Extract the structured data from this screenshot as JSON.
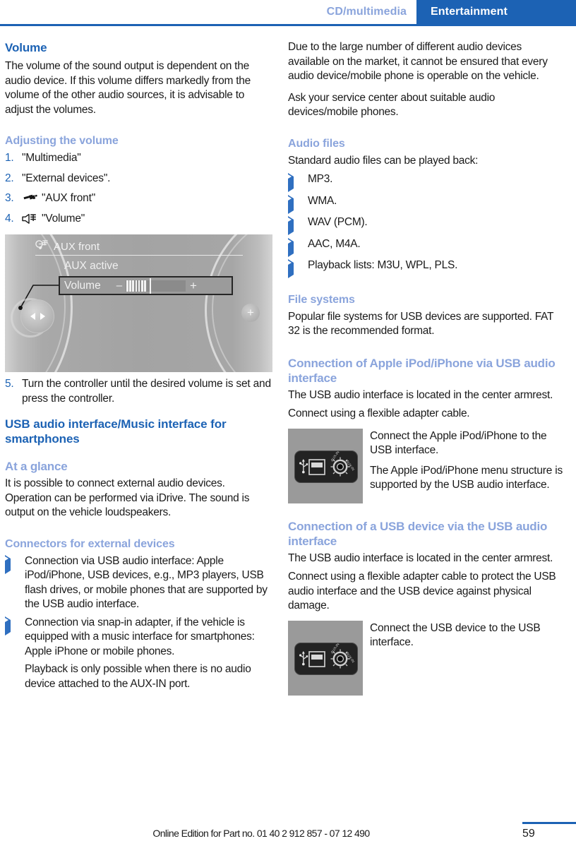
{
  "header": {
    "chapter": "CD/multimedia",
    "section": "Entertainment"
  },
  "left_column": {
    "volume_heading": "Volume",
    "volume_intro": "The volume of the sound output is dependent on the audio device. If this volume differs markedly from the volume of the other audio sources, it is advisable to adjust the volumes.",
    "adjusting_heading": "Adjusting the volume",
    "steps": [
      {
        "num": "1.",
        "icon": "",
        "text": "\"Multimedia\""
      },
      {
        "num": "2.",
        "icon": "",
        "text": "\"External devices\"."
      },
      {
        "num": "3.",
        "icon": "aux-plug-icon",
        "text": "\"AUX front\""
      },
      {
        "num": "4.",
        "icon": "speaker-volume-icon",
        "text": "\"Volume\""
      }
    ],
    "figure": {
      "title": "AUX front",
      "title_icon": "aux-front-icon",
      "status": "AUX active",
      "volume_label": "Volume",
      "minus": "–",
      "plus": "+"
    },
    "step5": {
      "num": "5.",
      "text": "Turn the controller until the desired volume is set and press the controller."
    },
    "usb_heading": "USB audio interface/Music interface for smartphones",
    "at_a_glance_heading": "At a glance",
    "at_a_glance_body": "It is possible to connect external audio devices. Operation can be performed via iDrive. The sound is output on the vehicle loudspeakers.",
    "connectors_heading": "Connectors for external devices",
    "connectors_bullets": [
      "Connection via USB audio interface: Apple iPod/iPhone, USB devices, e.g., MP3 players, USB flash drives, or mobile phones that are supported by the USB audio interface.",
      "Connection via snap-in adapter, if the vehicle is equipped with a music interface for smartphones: Apple iPhone or mobile phones."
    ],
    "connectors_note": "Playback is only possible when there is no audio device attached to the AUX-IN port."
  },
  "right_column": {
    "para_1": "Due to the large number of different audio devices available on the market, it cannot be ensured that every audio device/mobile phone is operable on the vehicle.",
    "para_2": "Ask your service center about suitable audio devices/mobile phones.",
    "audio_files_heading": "Audio files",
    "audio_files_intro": "Standard audio files can be played back:",
    "audio_files_bullets": [
      "MP3.",
      "WMA.",
      "WAV (PCM).",
      "AAC, M4A.",
      "Playback lists: M3U, WPL, PLS."
    ],
    "file_systems_heading": "File systems",
    "file_systems_body": "Popular file systems for USB devices are supported. FAT 32 is the recommended format.",
    "ipod_heading": "Connection of Apple iPod/iPhone via USB audio interface",
    "ipod_body_1": "The USB audio interface is located in the center armrest.",
    "ipod_body_2": "Connect using a flexible adapter cable.",
    "ipod_port_para_1": "Connect the Apple iPod/iPhone to the USB interface.",
    "ipod_port_para_2": "The Apple iPod/iPhone menu structure is supported by the USB audio interface.",
    "usbdev_heading": "Connection of a USB device via the USB audio interface",
    "usbdev_body_1": "The USB audio interface is located in the center armrest.",
    "usbdev_body_2": "Connect using a flexible adapter cable to protect the USB audio interface and the USB device against physical damage.",
    "usbdev_port_para_1": "Connect the USB device to the USB interface.",
    "port_labels": {
      "usb": "USB",
      "aux_left": "AUX-IN",
      "aux_right": "AUX-IN"
    }
  },
  "footer": {
    "note": "Online Edition for Part no. 01 40 2 912 857 - 07 12 490",
    "page_number": "59"
  },
  "colors": {
    "accent_dark": "#1c62b4",
    "accent_light": "#8aa4dc",
    "bullet": "#2f6fc0",
    "text": "#1a1a1a"
  }
}
